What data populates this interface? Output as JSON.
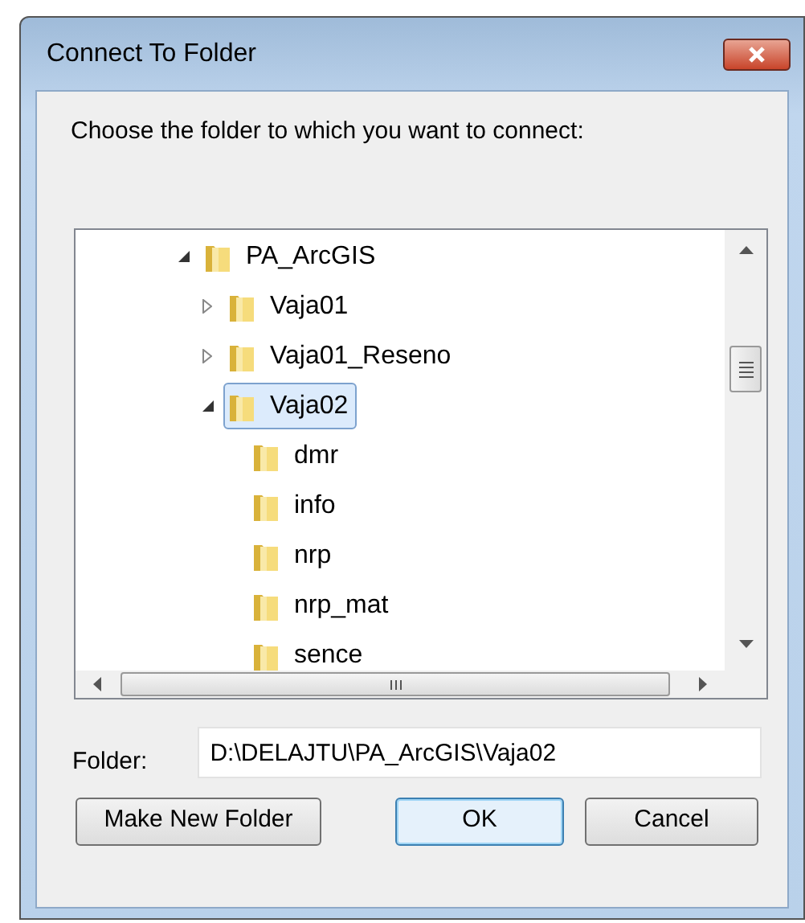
{
  "window": {
    "title": "Connect To Folder"
  },
  "instruction": "Choose the folder to which you want to connect:",
  "tree": [
    {
      "label": "PA_ArcGIS",
      "expanded": true,
      "selected": false,
      "children": [
        {
          "label": "Vaja01",
          "expanded": false,
          "selected": false
        },
        {
          "label": "Vaja01_Reseno",
          "expanded": false,
          "selected": false
        },
        {
          "label": "Vaja02",
          "expanded": true,
          "selected": true,
          "children": [
            {
              "label": "dmr",
              "selected": false
            },
            {
              "label": "info",
              "selected": false
            },
            {
              "label": "nrp",
              "selected": false
            },
            {
              "label": "nrp_mat",
              "selected": false
            },
            {
              "label": "sence",
              "selected": false
            }
          ]
        }
      ]
    }
  ],
  "folder_field": {
    "label": "Folder:",
    "value": "D:\\DELAJTU\\PA_ArcGIS\\Vaja02"
  },
  "buttons": [
    {
      "label": "Make New Folder",
      "default": false
    },
    {
      "label": "OK",
      "default": true
    },
    {
      "label": "Cancel",
      "default": false
    }
  ]
}
